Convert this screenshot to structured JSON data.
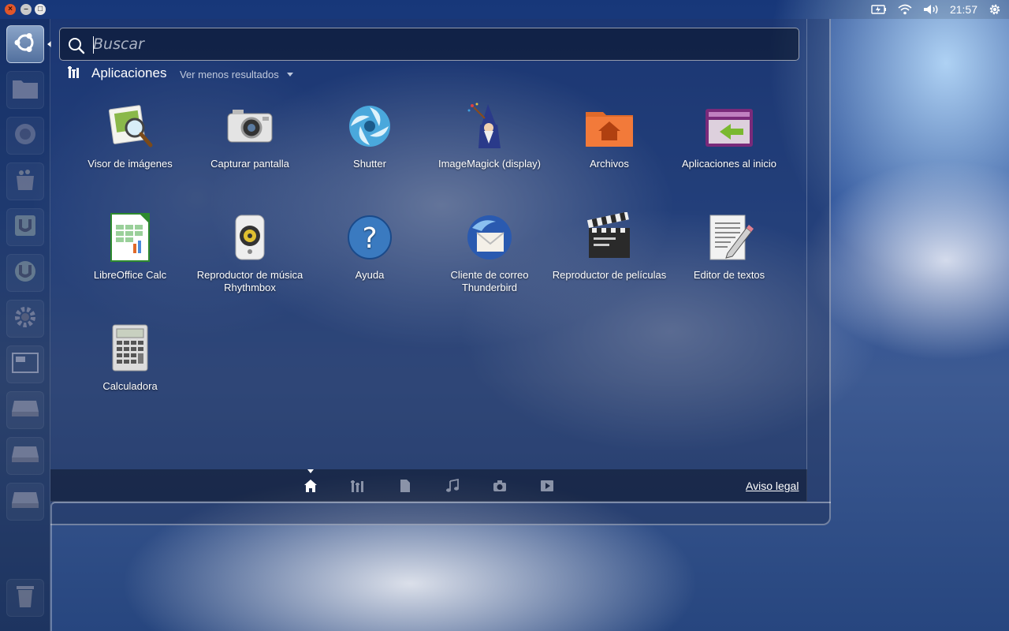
{
  "search": {
    "placeholder": "Buscar",
    "value": ""
  },
  "section": {
    "title": "Aplicaciones",
    "toggle_label": "Ver menos resultados"
  },
  "apps": [
    {
      "name": "Visor de imágenes",
      "icon": "image-viewer-icon"
    },
    {
      "name": "Capturar pantalla",
      "icon": "camera-icon"
    },
    {
      "name": "Shutter",
      "icon": "shutter-icon"
    },
    {
      "name": "ImageMagick (display)",
      "icon": "wizard-icon"
    },
    {
      "name": "Archivos",
      "icon": "home-folder-icon"
    },
    {
      "name": "Aplicaciones al inicio",
      "icon": "startup-apps-icon"
    },
    {
      "name": "LibreOffice Calc",
      "icon": "spreadsheet-icon"
    },
    {
      "name": "Reproductor de música Rhythmbox",
      "icon": "speaker-icon"
    },
    {
      "name": "Ayuda",
      "icon": "help-icon"
    },
    {
      "name": "Cliente de correo Thunderbird",
      "icon": "thunderbird-icon"
    },
    {
      "name": "Reproductor de películas",
      "icon": "clapperboard-icon"
    },
    {
      "name": "Editor de textos",
      "icon": "text-editor-icon"
    },
    {
      "name": "Calculadora",
      "icon": "calculator-icon"
    }
  ],
  "lenses": [
    {
      "name": "home-lens",
      "icon": "home-icon",
      "active": true
    },
    {
      "name": "applications-lens",
      "icon": "applications-icon",
      "active": false
    },
    {
      "name": "files-lens",
      "icon": "file-icon",
      "active": false
    },
    {
      "name": "music-lens",
      "icon": "music-note-icon",
      "active": false
    },
    {
      "name": "photos-lens",
      "icon": "camera-icon",
      "active": false
    },
    {
      "name": "video-lens",
      "icon": "play-icon",
      "active": false
    }
  ],
  "footer": {
    "legal_link": "Aviso legal"
  },
  "panel": {
    "clock": "21:57"
  },
  "launcher": [
    "ubuntu-logo-icon",
    "folder-icon",
    "firefox-icon",
    "software-center-icon",
    "ubuntu-one-icon",
    "ubuntu-one-music-icon",
    "settings-icon",
    "workspace-switcher-icon",
    "drive-icon",
    "drive-icon",
    "drive-icon",
    "trash-icon"
  ],
  "colors": {
    "window_close": "#e0562a",
    "accent": "#dd4814"
  }
}
